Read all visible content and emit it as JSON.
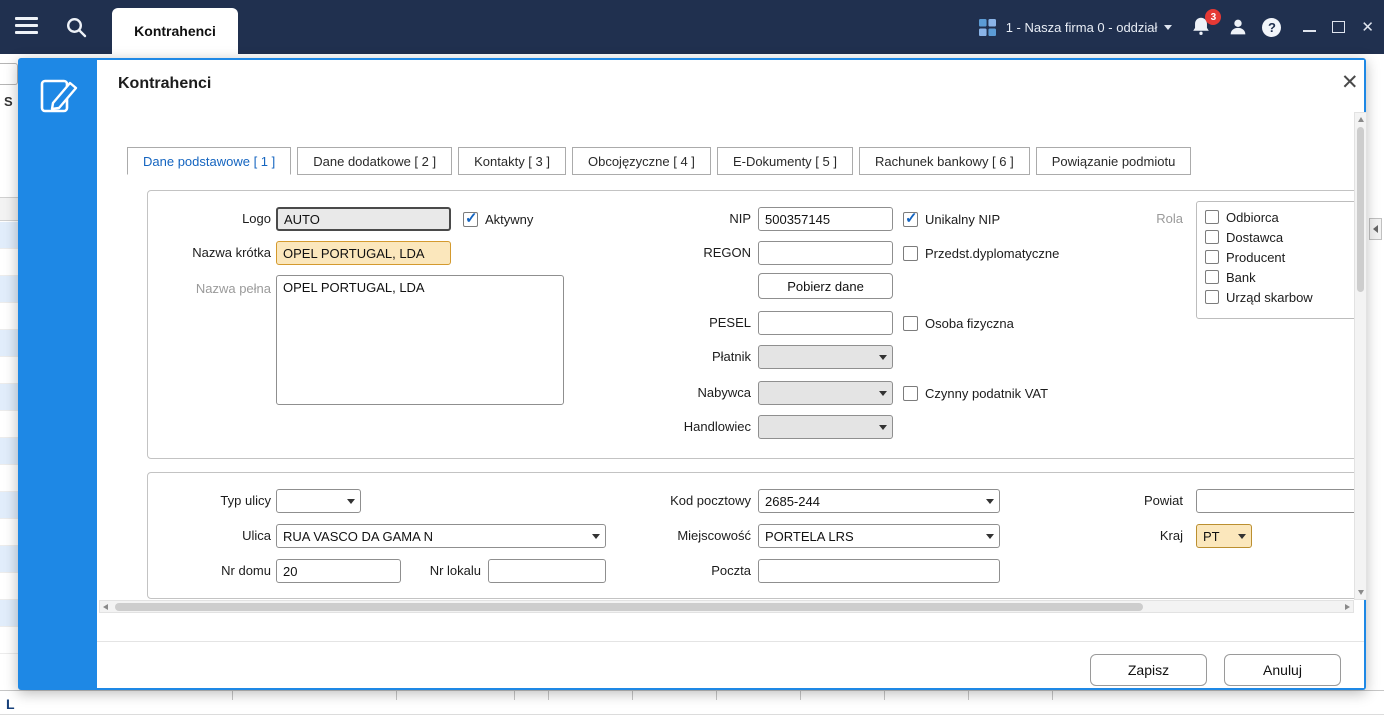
{
  "icons": {
    "close": "✕"
  },
  "topbar": {
    "tab_label": "Kontrahenci",
    "company_label": "1 - Nasza firma 0 - oddział",
    "badge_count": "3",
    "help_label": "?"
  },
  "background": {
    "partial_letter_top": "S",
    "partial_letter_bottom": "L"
  },
  "dialog": {
    "title": "Kontrahenci",
    "tabs": [
      {
        "label": "Dane podstawowe [ 1 ]"
      },
      {
        "label": "Dane dodatkowe [ 2 ]"
      },
      {
        "label": "Kontakty [ 3 ]"
      },
      {
        "label": "Obcojęzyczne [ 4 ]"
      },
      {
        "label": "E-Dokumenty [ 5 ]"
      },
      {
        "label": "Rachunek bankowy [ 6 ]"
      },
      {
        "label": "Powiązanie podmiotu"
      }
    ],
    "section1": {
      "logo": {
        "label": "Logo",
        "value": "AUTO"
      },
      "aktywny": {
        "label": "Aktywny",
        "checked": true
      },
      "nazwa_krotka": {
        "label": "Nazwa krótka",
        "value": "OPEL PORTUGAL, LDA"
      },
      "nazwa_pelna": {
        "label": "Nazwa pełna",
        "value": "OPEL PORTUGAL, LDA"
      },
      "nip": {
        "label": "NIP",
        "value": "500357145"
      },
      "unikalny_nip": {
        "label": "Unikalny NIP",
        "checked": true
      },
      "regon": {
        "label": "REGON",
        "value": ""
      },
      "przedst_dyplomatyczne": {
        "label": "Przedst.dyplomatyczne",
        "checked": false
      },
      "pobierz_dane_label": "Pobierz dane",
      "pesel": {
        "label": "PESEL",
        "value": ""
      },
      "osoba_fizyczna": {
        "label": "Osoba fizyczna",
        "checked": false
      },
      "platnik": {
        "label": "Płatnik",
        "value": ""
      },
      "nabywca": {
        "label": "Nabywca",
        "value": ""
      },
      "czynny_podatnik_vat": {
        "label": "Czynny podatnik VAT",
        "checked": false
      },
      "handlowiec": {
        "label": "Handlowiec",
        "value": ""
      },
      "rola": {
        "label": "Rola",
        "options": [
          {
            "label": "Odbiorca",
            "checked": false
          },
          {
            "label": "Dostawca",
            "checked": false
          },
          {
            "label": "Producent",
            "checked": false
          },
          {
            "label": "Bank",
            "checked": false
          },
          {
            "label": "Urząd skarbow",
            "checked": false
          }
        ]
      }
    },
    "section2": {
      "typ_ulicy": {
        "label": "Typ ulicy",
        "value": ""
      },
      "ulica": {
        "label": "Ulica",
        "value": "RUA VASCO DA GAMA N"
      },
      "nr_domu": {
        "label": "Nr domu",
        "value": "20"
      },
      "nr_lokalu": {
        "label": "Nr lokalu",
        "value": ""
      },
      "kod_pocztowy": {
        "label": "Kod pocztowy",
        "value": "2685-244"
      },
      "miejscowosc": {
        "label": "Miejscowość",
        "value": "PORTELA LRS"
      },
      "poczta": {
        "label": "Poczta",
        "value": ""
      },
      "powiat": {
        "label": "Powiat",
        "value": ""
      },
      "kraj": {
        "label": "Kraj",
        "value": "PT"
      }
    },
    "footer": {
      "save_label": "Zapisz",
      "cancel_label": "Anuluj"
    }
  },
  "colors": {
    "topbar_bg": "#20304f",
    "accent_blue": "#1e88e5",
    "active_tab_text": "#1565c0",
    "highlight_field_bg": "#fbe7bc",
    "highlight_field_border": "#d49a2e",
    "badge_red": "#e53935"
  }
}
